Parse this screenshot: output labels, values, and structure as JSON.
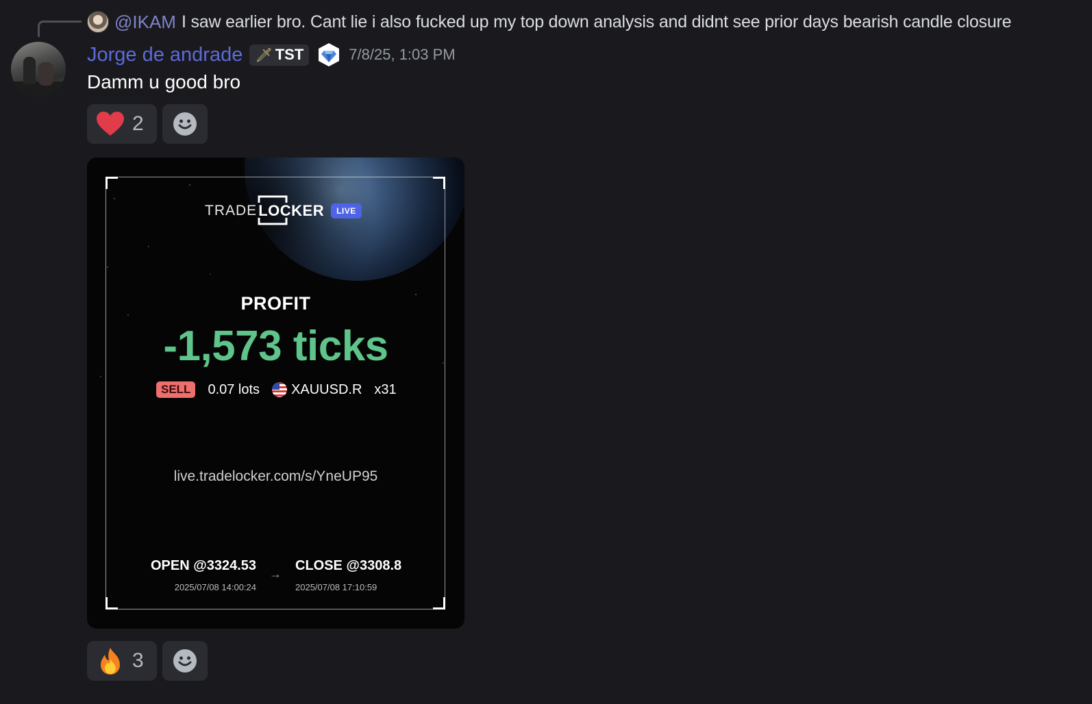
{
  "reply": {
    "mention": "@IKAM",
    "text": "I saw earlier bro. Cant lie i also fucked up my top down analysis and didnt see prior days bearish candle closure"
  },
  "message": {
    "username": "Jorge de andrade",
    "role_tag": "TST",
    "timestamp": "7/8/25, 1:03 PM",
    "content": "Damm u good bro"
  },
  "reactions_top": [
    {
      "emoji": "heart",
      "count": "2"
    }
  ],
  "reactions_bottom": [
    {
      "emoji": "fire",
      "count": "3"
    }
  ],
  "card": {
    "logo_trade": "TRADE",
    "logo_locker": "LOCKER",
    "live_badge": "LIVE",
    "profit_label": "PROFIT",
    "profit_value": "-1,573 ticks",
    "side": "SELL",
    "lots": "0.07 lots",
    "symbol": "XAUUSD.R",
    "leverage": "x31",
    "share_url": "live.tradelocker.com/s/YneUP95",
    "open_label": "OPEN @3324.53",
    "open_time": "2025/07/08 14:00:24",
    "close_label": "CLOSE @3308.8",
    "close_time": "2025/07/08 17:10:59"
  },
  "colors": {
    "background": "#1a1a1e",
    "username": "#5c6bd9",
    "mention": "#7f83c9",
    "profit": "#5ec48a",
    "sell": "#ef6e6e",
    "live": "#4f63e6"
  }
}
